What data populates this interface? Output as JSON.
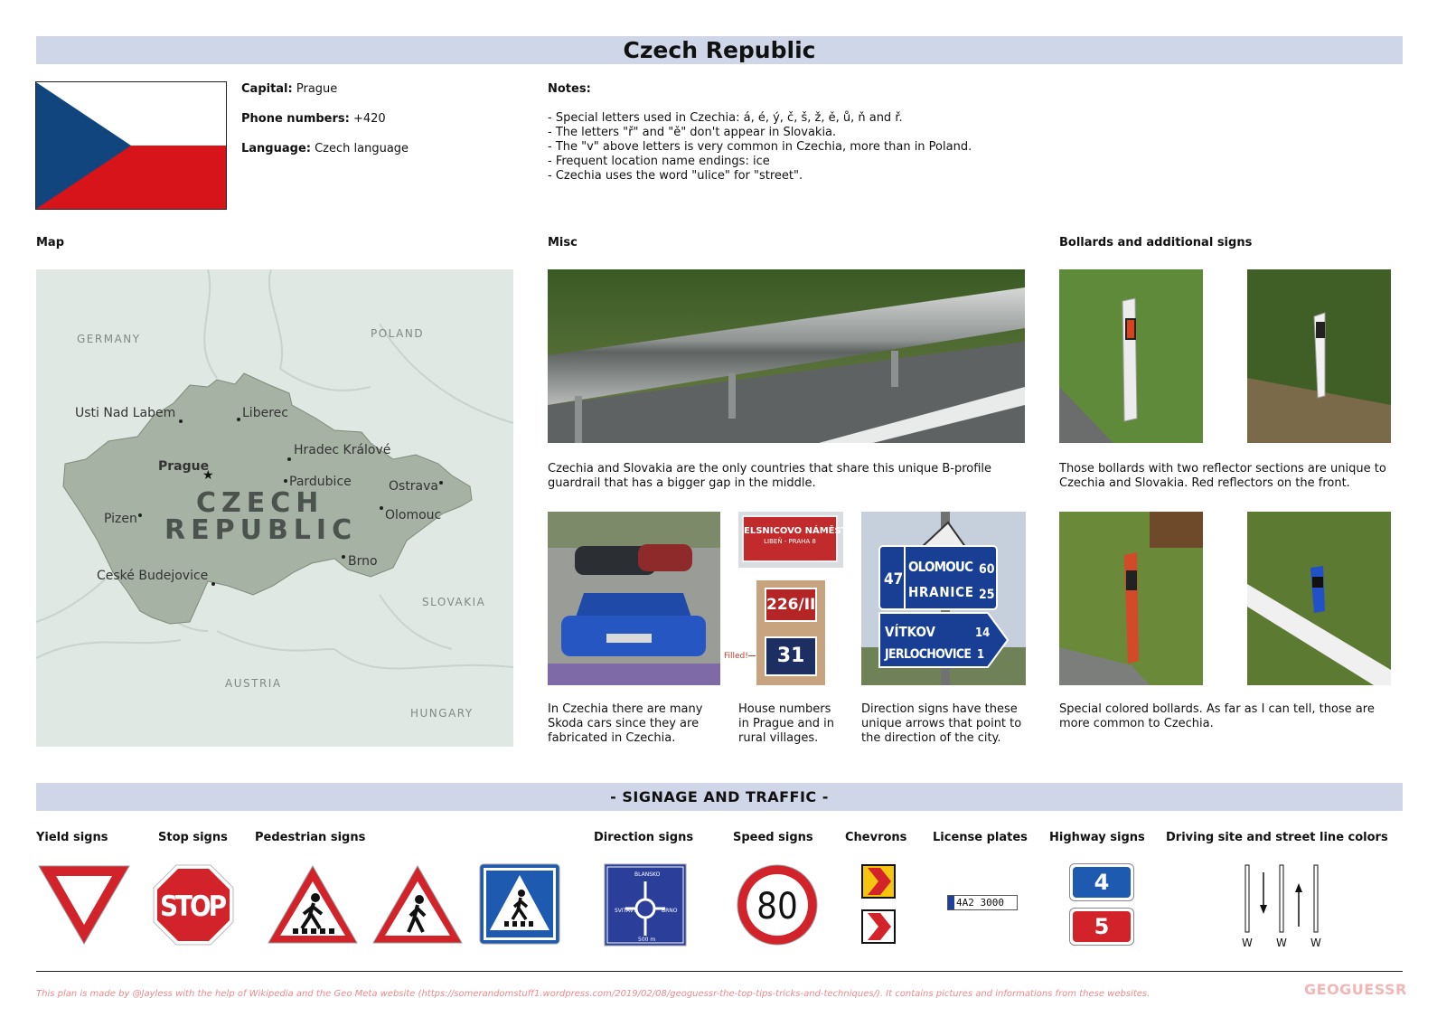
{
  "title": "Czech Republic",
  "info": {
    "capital_label": "Capital:",
    "capital": "Prague",
    "phone_label": "Phone numbers:",
    "phone": "+420",
    "language_label": "Language:",
    "language": "Czech language"
  },
  "notes": {
    "heading": "Notes:",
    "lines": [
      "- Special letters used in Czechia: á, é, ý, č, š, ž, ě, ů, ň and ř.",
      "- The letters \"ř\" and \"ě\" don't appear in Slovakia.",
      "- The \"v\" above letters is very common in Czechia, more than in Poland.",
      "- Frequent location name endings: ice",
      "- Czechia uses the word \"ulice\" for \"street\"."
    ]
  },
  "sections": {
    "map": "Map",
    "misc": "Misc",
    "bollards": "Bollards and additional signs"
  },
  "map": {
    "countries": [
      "GERMANY",
      "POLAND",
      "SLOVAKIA",
      "AUSTRIA",
      "HUNGARY"
    ],
    "country_name": [
      "CZECH",
      "REPUBLIC"
    ],
    "cities": [
      "Usti Nad Labem",
      "Liberec",
      "Prague",
      "Hradec Králové",
      "Pardubice",
      "Ostrava",
      "Pizen",
      "Olomouc",
      "Brno",
      "Ceské Budejovice"
    ]
  },
  "misc": {
    "guardrail_caption": "Czechia and Slovakia are the only countries that share this unique B-profile guardrail that has a bigger gap in the middle.",
    "skoda_caption": "In Czechia there are many Skoda cars since they are fabricated in Czechia.",
    "house_caption": "House numbers in Prague and in rural villages.",
    "direction_caption": "Direction signs have these unique arrows that point to the direction of the city.",
    "filled_label": "Filled!",
    "street_sign": [
      "ELSNICOVO NÁMĚSTÍ",
      "LIBEŇ - PRAHA 8"
    ],
    "house_numbers": [
      "226/II",
      "31"
    ],
    "direction_sign": {
      "top": [
        {
          "name": "OLOMOUC",
          "km": "60"
        },
        {
          "name": "HRANICE",
          "km": "25"
        }
      ],
      "top_road": "47",
      "arrow": [
        {
          "name": "VÍTKOV",
          "km": "14"
        },
        {
          "name": "JERLOCHOVICE",
          "km": "1"
        }
      ]
    }
  },
  "bollards": {
    "caption1": "Those bollards with two reflector sections are unique to Czechia and Slovakia. Red reflectors on the front.",
    "caption2": "Special colored bollards. As far as I can tell, those are more common to Czechia."
  },
  "signage": {
    "heading": "- SIGNAGE AND TRAFFIC -",
    "categories": [
      "Yield signs",
      "Stop signs",
      "Pedestrian signs",
      "Direction signs",
      "Speed signs",
      "Chevrons",
      "License plates",
      "Highway signs",
      "Driving site and street line colors"
    ],
    "stop_text": "STOP",
    "speed_value": "80",
    "license_plate": "4A2 3000",
    "highway_numbers": [
      "4",
      "5"
    ],
    "line_labels": [
      "W",
      "W",
      "W"
    ],
    "direction_sign_texts": [
      "BLANSKO",
      "SVITAVY",
      "BRNO",
      "500 m"
    ]
  },
  "footer": {
    "credit": "This plan is made by @Jayless with the help of Wikipedia and the Geo Meta website (https://somerandomstuff1.wordpress.com/2019/02/08/geoguessr-the-top-tips-tricks-and-techniques/). It contains pictures and informations from these websites.",
    "logo": "GEOGUESSR"
  },
  "colors": {
    "band": "#cfd6e8",
    "flag_blue": "#11457e",
    "flag_red": "#d7141a",
    "sign_red": "#d2232a",
    "sign_blue": "#1e5bb0"
  }
}
